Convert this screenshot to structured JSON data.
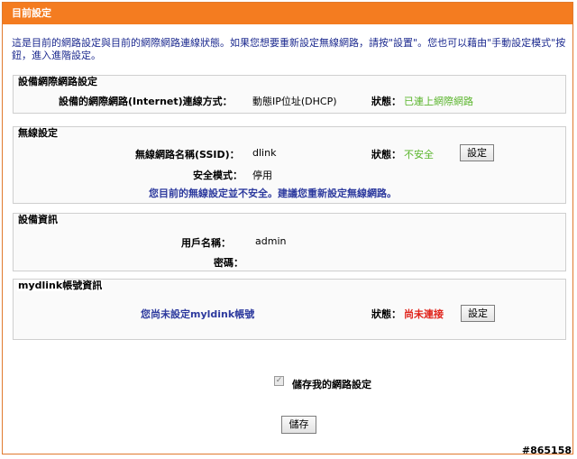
{
  "header": {
    "title": "目前設定"
  },
  "intro": {
    "text": "這是目前的網路設定與目前的網際網路連線狀態。如果您想要重新設定無線網路，請按\"設置\"。您也可以藉由\"手動設定模式\"按鈕，進入進階設定。"
  },
  "network": {
    "title": "設備網際網路設定",
    "conn_label": "設備的網際網路(Internet)連線方式：",
    "conn_value": "動態IP位址(DHCP)",
    "status_label": "狀態：",
    "status_value": "已連上網際網路"
  },
  "wireless": {
    "title": "無線設定",
    "ssid_label": "無線網路名稱(SSID)：",
    "ssid_value": "dlink",
    "status_label": "狀態：",
    "status_value": "不安全",
    "setup_button": "設定",
    "security_label": "安全模式：",
    "security_value": "停用",
    "warning": "您目前的無線設定並不安全。建議您重新設定無線網路。"
  },
  "device": {
    "title": "設備資訊",
    "user_label": "用戶名稱：",
    "user_value": "admin",
    "password_label": "密碼："
  },
  "mydlink": {
    "title": "mydlink帳號資訊",
    "message": "您尚未設定myldink帳號",
    "status_label": "狀態：",
    "status_value": "尚未連接",
    "setup_button": "設定"
  },
  "save": {
    "checkbox_label": "儲存我的網路設定",
    "checked": true,
    "button": "儲存"
  },
  "watermark": "#865158",
  "colors": {
    "header": "#f47c20",
    "ok": "#5bb52d",
    "error": "#e0231b",
    "info": "#2d3a9e"
  }
}
